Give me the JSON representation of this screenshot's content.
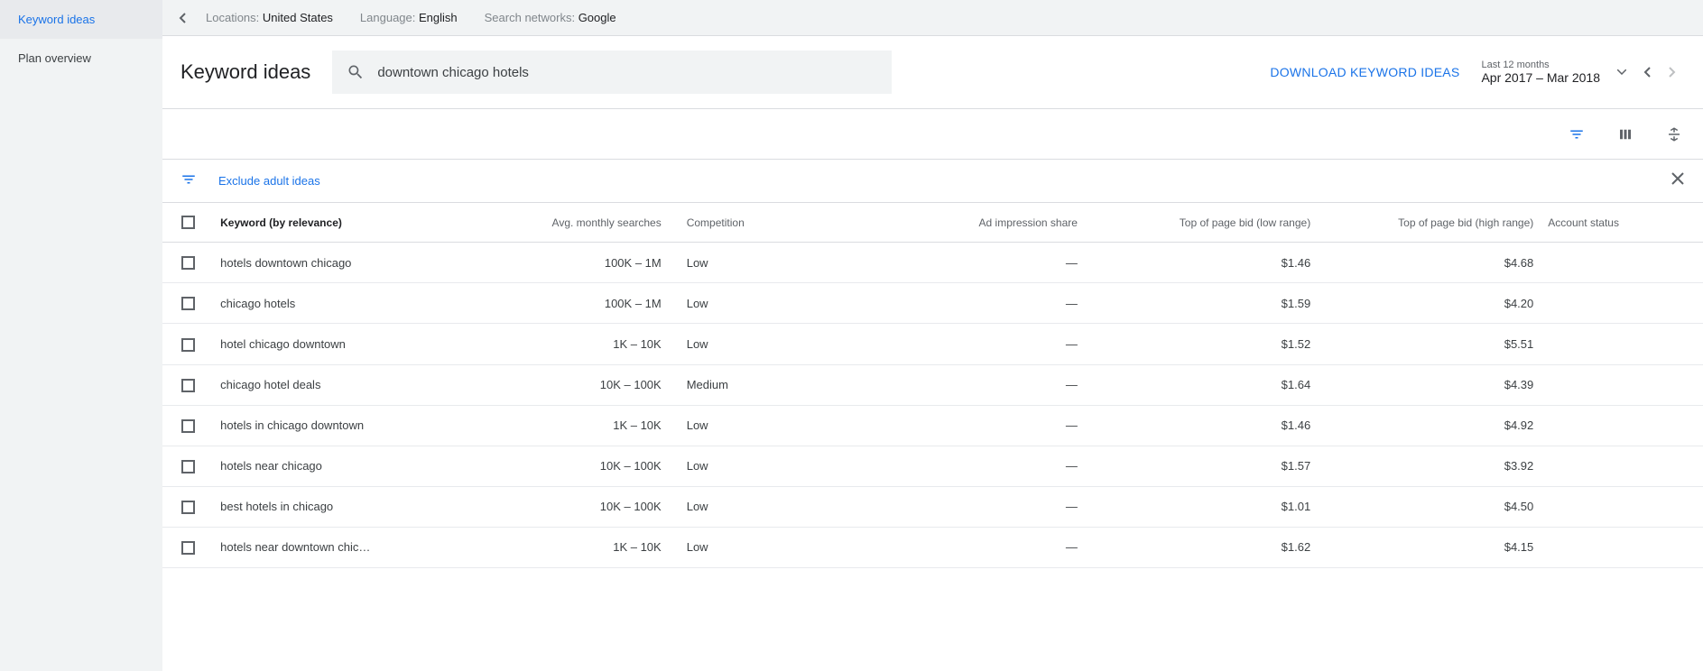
{
  "sidebar": {
    "items": [
      {
        "label": "Keyword ideas",
        "active": true
      },
      {
        "label": "Plan overview",
        "active": false
      }
    ]
  },
  "topbar": {
    "locations_label": "Locations: ",
    "locations_value": "United States",
    "language_label": "Language: ",
    "language_value": "English",
    "networks_label": "Search networks: ",
    "networks_value": "Google"
  },
  "header": {
    "title": "Keyword ideas",
    "search_value": "downtown chicago hotels",
    "download_label": "DOWNLOAD KEYWORD IDEAS",
    "date_small": "Last 12 months",
    "date_big": "Apr 2017 – Mar 2018"
  },
  "filter": {
    "text": "Exclude adult ideas"
  },
  "table": {
    "headers": {
      "keyword": "Keyword (by relevance)",
      "searches": "Avg. monthly searches",
      "competition": "Competition",
      "impression": "Ad impression share",
      "lowbid": "Top of page bid (low range)",
      "highbid": "Top of page bid (high range)",
      "status": "Account status"
    },
    "rows": [
      {
        "keyword": "hotels downtown chicago",
        "searches": "100K – 1M",
        "competition": "Low",
        "impression": "—",
        "lowbid": "$1.46",
        "highbid": "$4.68",
        "status": ""
      },
      {
        "keyword": "chicago hotels",
        "searches": "100K – 1M",
        "competition": "Low",
        "impression": "—",
        "lowbid": "$1.59",
        "highbid": "$4.20",
        "status": ""
      },
      {
        "keyword": "hotel chicago downtown",
        "searches": "1K – 10K",
        "competition": "Low",
        "impression": "—",
        "lowbid": "$1.52",
        "highbid": "$5.51",
        "status": ""
      },
      {
        "keyword": "chicago hotel deals",
        "searches": "10K – 100K",
        "competition": "Medium",
        "impression": "—",
        "lowbid": "$1.64",
        "highbid": "$4.39",
        "status": ""
      },
      {
        "keyword": "hotels in chicago downtown",
        "searches": "1K – 10K",
        "competition": "Low",
        "impression": "—",
        "lowbid": "$1.46",
        "highbid": "$4.92",
        "status": ""
      },
      {
        "keyword": "hotels near chicago",
        "searches": "10K – 100K",
        "competition": "Low",
        "impression": "—",
        "lowbid": "$1.57",
        "highbid": "$3.92",
        "status": ""
      },
      {
        "keyword": "best hotels in chicago",
        "searches": "10K – 100K",
        "competition": "Low",
        "impression": "—",
        "lowbid": "$1.01",
        "highbid": "$4.50",
        "status": ""
      },
      {
        "keyword": "hotels near downtown chic…",
        "searches": "1K – 10K",
        "competition": "Low",
        "impression": "—",
        "lowbid": "$1.62",
        "highbid": "$4.15",
        "status": ""
      }
    ]
  }
}
